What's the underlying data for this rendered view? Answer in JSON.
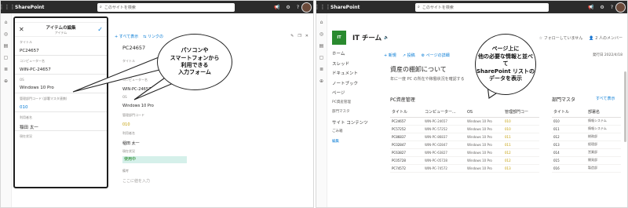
{
  "left": {
    "topbar": {
      "app_name": "SharePoint",
      "search_placeholder": "このサイトを検索"
    },
    "phone": {
      "title": "アイテムの編集",
      "subtitle": "アイテム",
      "fields": [
        {
          "label": "タイトル",
          "value": "PC24657",
          "color": ""
        },
        {
          "label": "コンピューター名",
          "value": "WIN-PC-24657",
          "color": ""
        },
        {
          "label": "OS",
          "value": "Windows 10 Pro",
          "color": ""
        },
        {
          "label": "管理部門コード (部署マスタ連携)",
          "value": "010",
          "color": "blue"
        },
        {
          "label": "利用者名",
          "value": "稲田 太一",
          "color": ""
        },
        {
          "label": "現在状況",
          "value": "",
          "color": ""
        }
      ]
    },
    "form": {
      "command": {
        "new": "すべて表示",
        "link": "リンクの",
        "edit": "編集"
      },
      "record_title": "PC24657",
      "fields": [
        {
          "label": "タイトル",
          "value": ""
        },
        {
          "label": "コンピューター名",
          "value": "WIN-PC-24657"
        },
        {
          "label": "OS",
          "value": "Windows 10 Pro"
        },
        {
          "label": "管理部門コード",
          "value": "010"
        },
        {
          "label": "利用者名",
          "value": "稲田 太一"
        },
        {
          "label": "現在状況",
          "value": "使用中"
        },
        {
          "label": "備考",
          "value": "ここに値を入力"
        }
      ]
    },
    "callout": {
      "line1": "パソコンや",
      "line2": "スマートフォンから",
      "line3": "利用できる",
      "line4": "入力フォーム"
    }
  },
  "right": {
    "topbar": {
      "app_name": "SharePoint",
      "search_placeholder": "このサイトを検索"
    },
    "site": {
      "logo": "IT",
      "name": "IT チーム",
      "follow": "フォローしていません",
      "members": "2 人のメンバー"
    },
    "nav": [
      {
        "label": "ホーム",
        "kind": ""
      },
      {
        "label": "スレッド",
        "kind": ""
      },
      {
        "label": "ドキュメント",
        "kind": ""
      },
      {
        "label": "ノートブック",
        "kind": ""
      },
      {
        "label": "ページ",
        "kind": ""
      },
      {
        "label": "PC資産管理",
        "kind": "small"
      },
      {
        "label": "部門マスタ",
        "kind": "small"
      },
      {
        "label": "サイト コンテンツ",
        "kind": ""
      },
      {
        "label": "ごみ箱",
        "kind": "small"
      },
      {
        "label": "編集",
        "kind": "edit"
      }
    ],
    "command": {
      "new": "新規",
      "promote": "投稿",
      "page_details": "ページの詳細",
      "published": "発行日 2022/4/18"
    },
    "page": {
      "title": "資産の棚卸について",
      "subtitle": "年に一度 PC の所在や稼働状況を確認する"
    },
    "pc_list": {
      "title": "PC資産管理",
      "headers": [
        "タイトル",
        "コンピューター...",
        "OS",
        "管理部門コー"
      ],
      "rows": [
        [
          "PC24657",
          "WIN-PC-24657",
          "Windows 10 Pro",
          "010"
        ],
        [
          "PC57252",
          "WIN-PC-57252",
          "Windows 10 Pro",
          "010"
        ],
        [
          "PC86837",
          "WIN-PC-86837",
          "Windows 10 Pro",
          "011"
        ],
        [
          "PC02847",
          "WIN-PC-02847",
          "Windows 10 Pro",
          "011"
        ],
        [
          "PC63827",
          "WIN-PC-63827",
          "Windows 10 Pro",
          "012"
        ],
        [
          "PC05728",
          "WIN-PC-05728",
          "Windows 10 Pro",
          "012"
        ],
        [
          "PC74572",
          "WIN-PC-74572",
          "Windows 10 Pro",
          "013"
        ]
      ]
    },
    "dept_list": {
      "title": "部門マスタ",
      "link": "すべて表示",
      "headers": [
        "タイトル",
        "部署名"
      ],
      "rows": [
        [
          "010",
          "情報システム"
        ],
        [
          "011",
          "情報システム"
        ],
        [
          "012",
          "総務部"
        ],
        [
          "013",
          "経理部"
        ],
        [
          "014",
          "営業部"
        ],
        [
          "015",
          "開発部"
        ],
        [
          "016",
          "製造部"
        ]
      ]
    },
    "callout": {
      "line1": "ページ上に",
      "line2": "他の必要な情報と並べて",
      "line3": "SharePoint リストの",
      "line4": "データを表示"
    }
  }
}
